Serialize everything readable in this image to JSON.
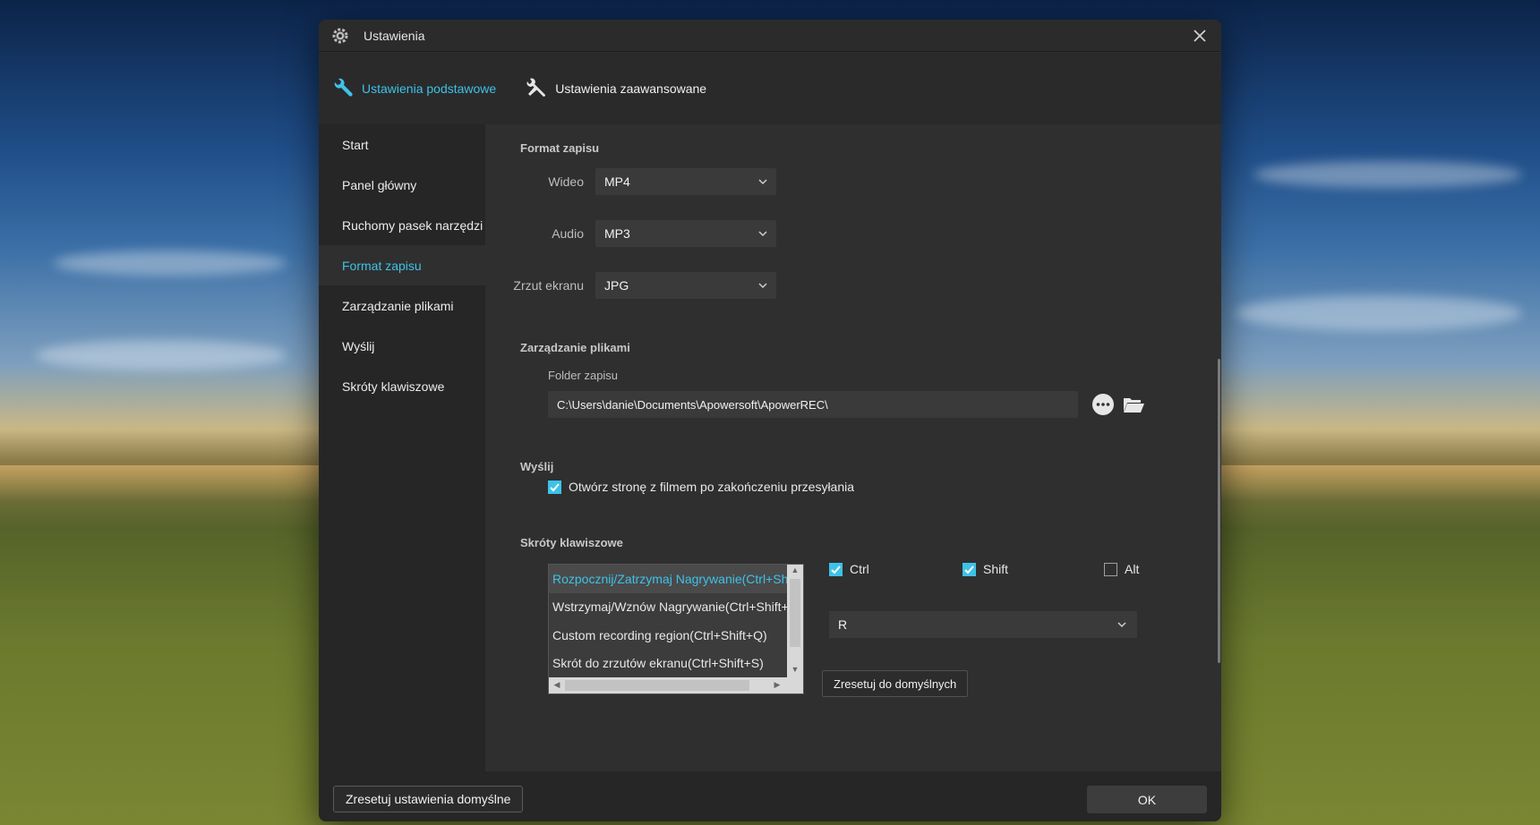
{
  "window": {
    "title": "Ustawienia",
    "title_icon": "gear-icon",
    "close_icon": "close-icon"
  },
  "tabs": [
    {
      "label": "Ustawienia podstawowe",
      "icon": "wrench-icon",
      "active": true
    },
    {
      "label": "Ustawienia zaawansowane",
      "icon": "tools-icon",
      "active": false
    }
  ],
  "sidebar": {
    "items": [
      {
        "label": "Start"
      },
      {
        "label": "Panel główny"
      },
      {
        "label": "Ruchomy pasek narzędzi"
      },
      {
        "label": "Format zapisu"
      },
      {
        "label": "Zarządzanie plikami"
      },
      {
        "label": "Wyślij"
      },
      {
        "label": "Skróty klawiszowe"
      }
    ],
    "active_index": 3
  },
  "format": {
    "section_title": "Format zapisu",
    "video_label": "Wideo",
    "video_value": "MP4",
    "audio_label": "Audio",
    "audio_value": "MP3",
    "screenshot_label": "Zrzut ekranu",
    "screenshot_value": "JPG"
  },
  "files": {
    "section_title": "Zarządzanie plikami",
    "folder_label": "Folder zapisu",
    "folder_path": "C:\\Users\\danie\\Documents\\Apowersoft\\ApowerREC\\",
    "more_icon": "more-dots-icon",
    "folder_icon": "folder-open-icon"
  },
  "upload": {
    "section_title": "Wyślij",
    "open_page_label": "Otwórz stronę z filmem po zakończeniu przesyłania",
    "open_page_checked": true
  },
  "shortcuts": {
    "section_title": "Skróty klawiszowe",
    "items": [
      "Rozpocznij/Zatrzymaj Nagrywanie(Ctrl+Shift+R)",
      "Wstrzymaj/Wznów Nagrywanie(Ctrl+Shift+D)",
      "Custom recording region(Ctrl+Shift+Q)",
      "Skrót do zrzutów ekranu(Ctrl+Shift+S)"
    ],
    "selected_index": 0,
    "ctrl_label": "Ctrl",
    "ctrl_checked": true,
    "shift_label": "Shift",
    "shift_checked": true,
    "alt_label": "Alt",
    "alt_checked": false,
    "key_value": "R",
    "reset_label": "Zresetuj do domyślnych"
  },
  "footer": {
    "reset_all_label": "Zresetuj ustawienia domyślne",
    "ok_label": "OK"
  },
  "colors": {
    "accent": "#3ec2e8",
    "dialog_bg": "#2f2f2f",
    "sidebar_bg": "#262626"
  }
}
